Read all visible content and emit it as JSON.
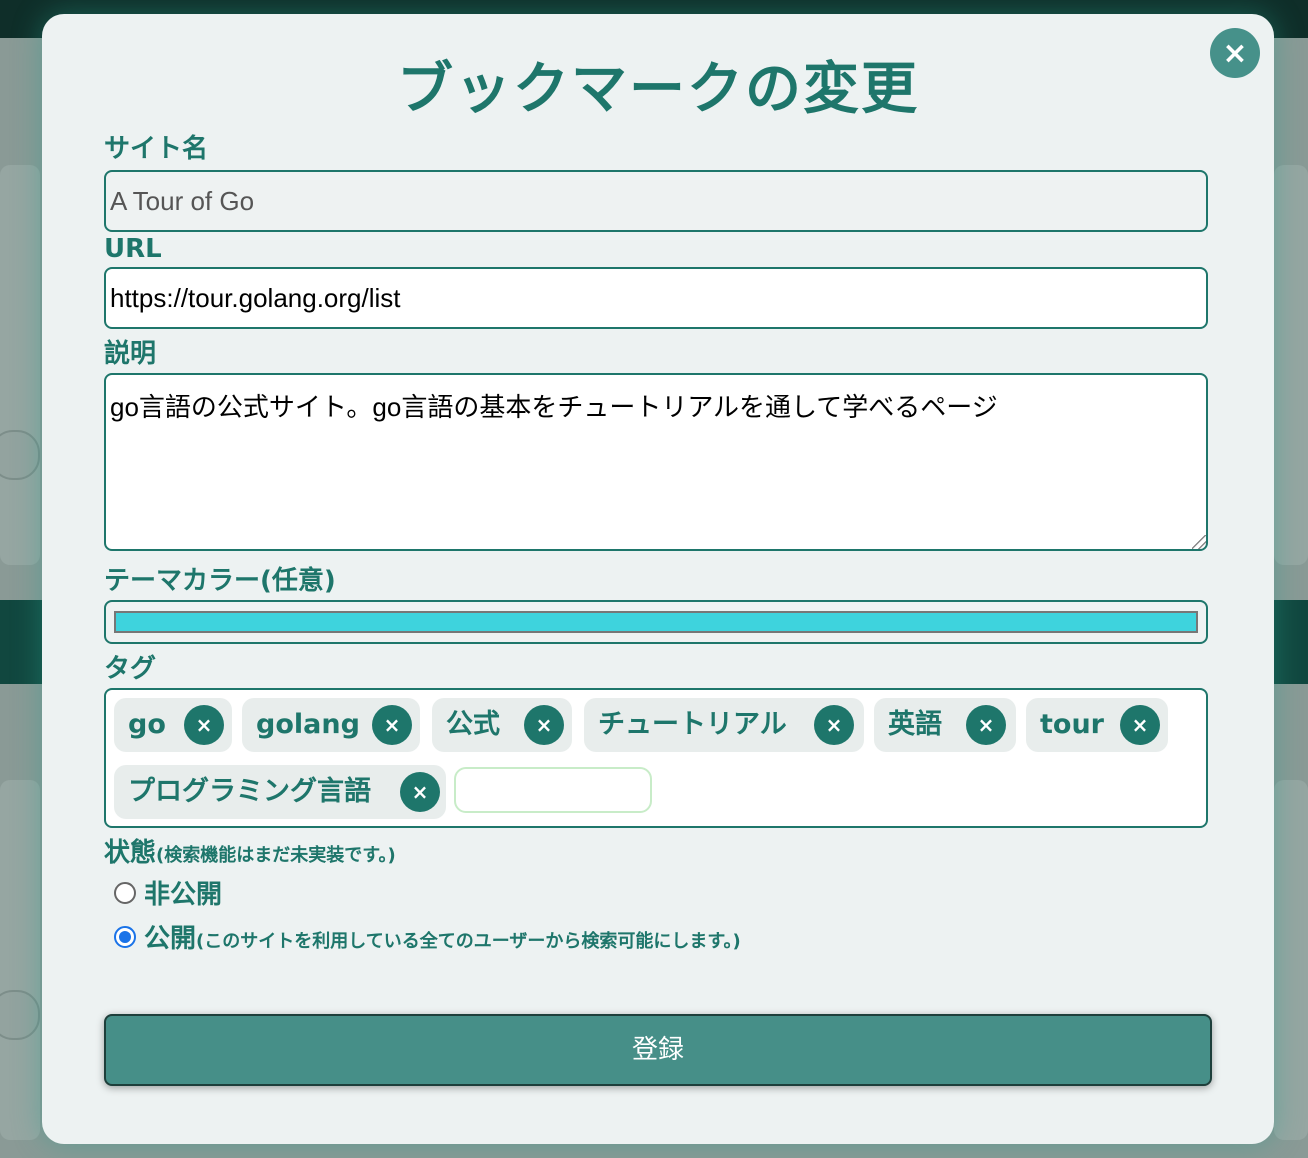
{
  "modal": {
    "title": "ブックマークの変更",
    "close_icon": "×",
    "site_name": {
      "label": "サイト名",
      "value": "A Tour of Go"
    },
    "url": {
      "label": "URL",
      "value": "https://tour.golang.org/list"
    },
    "description": {
      "label": "説明",
      "value": "go言語の公式サイト。go言語の基本をチュートリアルを通して学べるページ"
    },
    "theme_color": {
      "label": "テーマカラー(任意)",
      "value": "#3ed3dd"
    },
    "tags": {
      "label": "タグ",
      "items": [
        "go",
        "golang",
        "公式",
        "チュートリアル",
        "英語",
        "tour",
        "プログラミング言語"
      ],
      "remove_icon": "×",
      "input_value": ""
    },
    "status": {
      "label": "状態",
      "note": "(検索機能はまだ未実装です。)",
      "options": [
        {
          "label": "非公開",
          "note": "",
          "selected": false
        },
        {
          "label": "公開",
          "note": "(このサイトを利用している全てのユーザーから検索可能にします。)",
          "selected": true
        }
      ]
    },
    "submit_label": "登録"
  }
}
